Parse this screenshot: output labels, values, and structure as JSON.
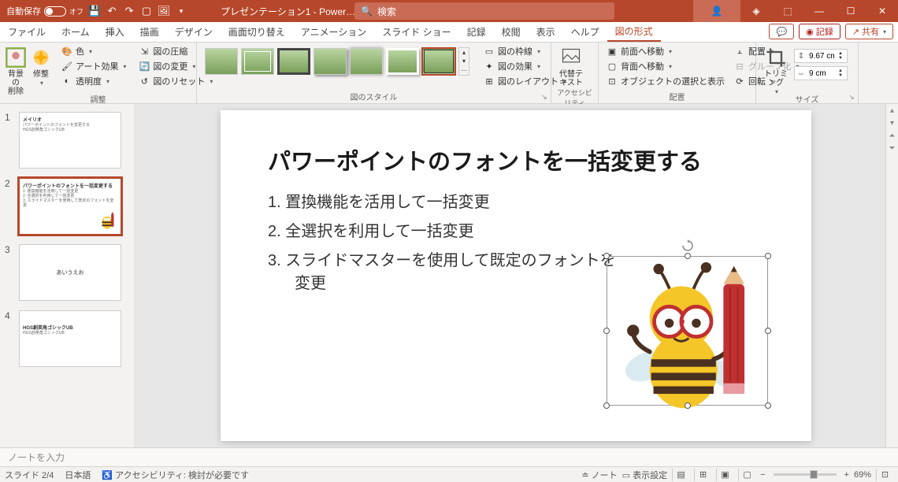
{
  "titlebar": {
    "autosave_label": "自動保存",
    "autosave_state": "オフ",
    "doc_title": "プレゼンテーション1 - Power…",
    "search_placeholder": "検索"
  },
  "tabs": {
    "items": [
      "ファイル",
      "ホーム",
      "挿入",
      "描画",
      "デザイン",
      "画面切り替え",
      "アニメーション",
      "スライド ショー",
      "記録",
      "校閲",
      "表示",
      "ヘルプ",
      "図の形式"
    ],
    "active_index": 12,
    "comment_btn": "💬",
    "record_btn": "記録",
    "share_btn": "共有"
  },
  "ribbon": {
    "group1": {
      "label": "調整",
      "remove_bg": "背景の\n削除",
      "corrections": "修整",
      "color": "色",
      "art": "アート効果",
      "transparency": "透明度",
      "compress": "図の圧縮",
      "change": "図の変更",
      "reset": "図のリセット"
    },
    "group2": {
      "label": "図のスタイル",
      "border": "図の枠線",
      "effects": "図の効果",
      "layout": "図のレイアウト"
    },
    "group3": {
      "label": "アクセシビリティ",
      "alt": "代替テ\nキスト"
    },
    "group4": {
      "label": "配置",
      "front": "前面へ移動",
      "back": "背面へ移動",
      "select": "オブジェクトの選択と表示",
      "align": "配置",
      "group": "グループ化",
      "rotate": "回転"
    },
    "group5": {
      "label": "サイズ",
      "trim": "トリミング",
      "height": "9.67 cm",
      "width": "9 cm"
    }
  },
  "thumbs": {
    "slides": [
      {
        "num": "1",
        "title": "メイリオ",
        "lines": [
          "パワーポイントのフォントを変更する",
          "HGS創英角ゴシックUB",
          "…"
        ]
      },
      {
        "num": "2",
        "title": "パワーポイントのフォントを一括変更する",
        "lines": [
          "1. 置換機能を活用して一括変更",
          "2. 全選択を利用して一括変更",
          "3. スライドマスターを使用して既定のフォントを変更"
        ]
      },
      {
        "num": "3",
        "title": "",
        "lines": [
          "あいうえお"
        ]
      },
      {
        "num": "4",
        "title": "HGS創英角ゴシックUB",
        "lines": [
          "HGS創英角ゴシックUB"
        ]
      }
    ],
    "selected_index": 1
  },
  "slide": {
    "title": "パワーポイントのフォントを一括変更する",
    "items": [
      "置換機能を活用して一括変更",
      "全選択を利用して一括変更",
      "スライドマスターを使用して既定のフォントを"
    ],
    "item3_wrap": "変更"
  },
  "notes": {
    "placeholder": "ノートを入力"
  },
  "statusbar": {
    "slide_num": "スライド 2/4",
    "lang": "日本語",
    "a11y": "アクセシビリティ: 検討が必要です",
    "notes_btn": "ノート",
    "display_btn": "表示設定",
    "zoom": "69%"
  }
}
